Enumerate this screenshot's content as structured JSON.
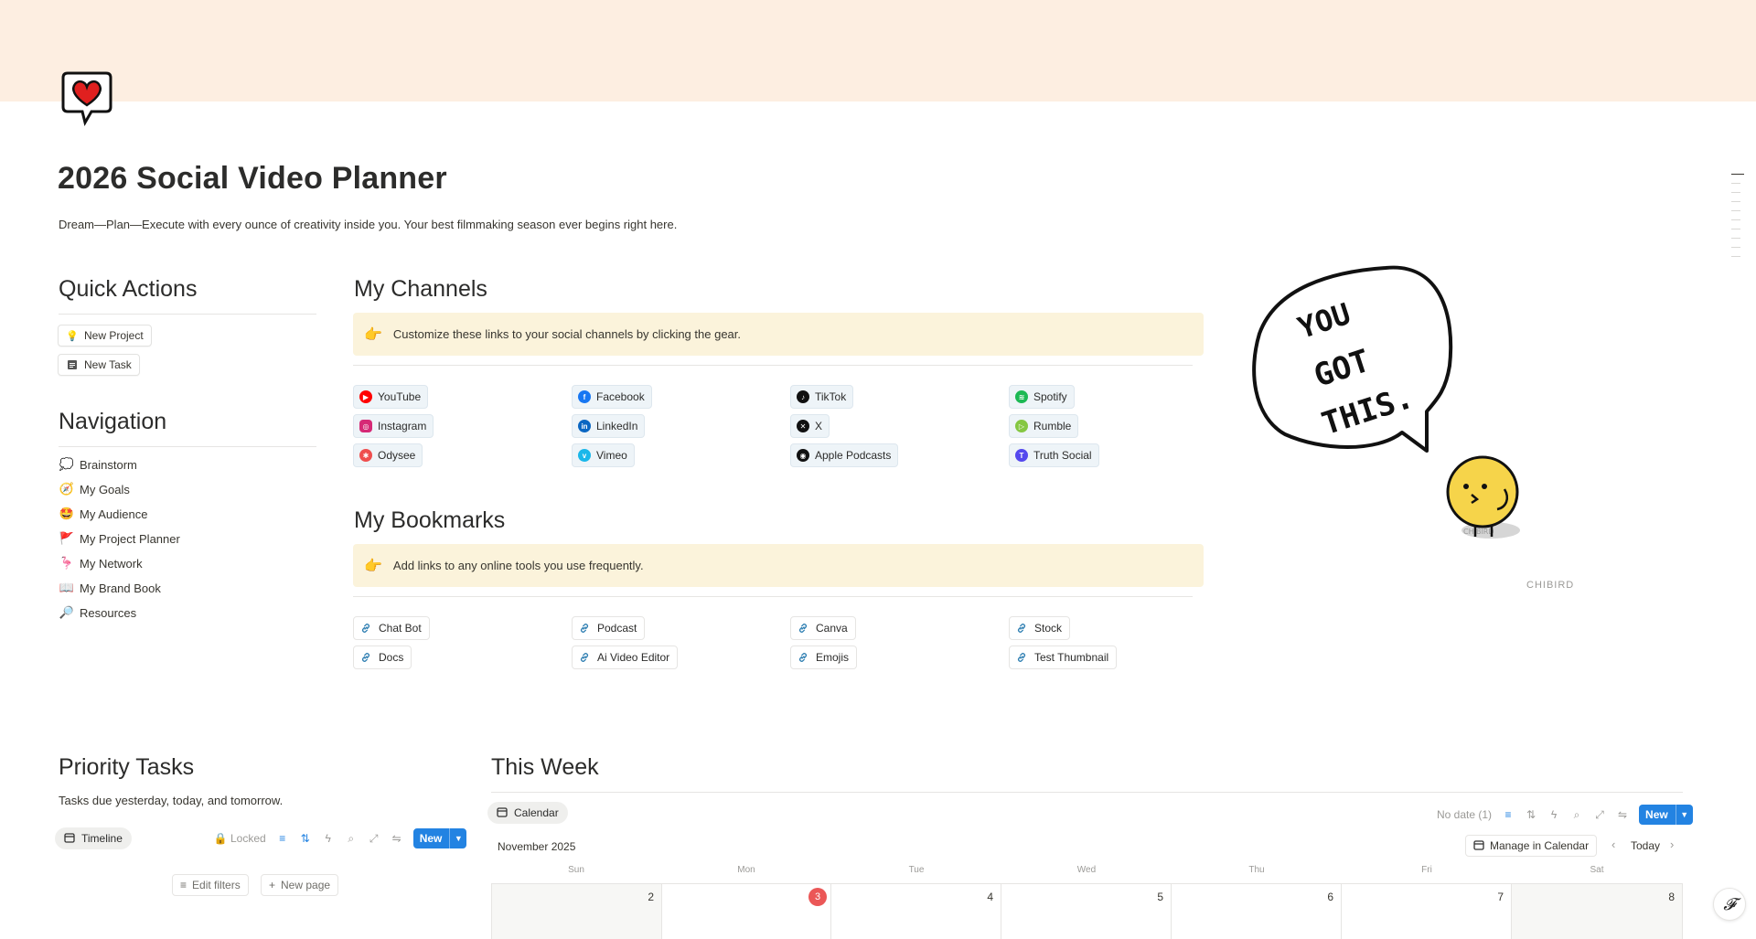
{
  "page": {
    "title": "2026 Social Video Planner",
    "subtitle": "Dream—Plan—Execute with every ounce of creativity inside you. Your best filmmaking season ever begins right here.",
    "icon": "heart-speech-bubble-icon"
  },
  "quick_actions": {
    "heading": "Quick Actions",
    "buttons": [
      {
        "label": "New Project",
        "icon": "lightbulb-icon"
      },
      {
        "label": "New Task",
        "icon": "notepad-icon"
      }
    ]
  },
  "navigation": {
    "heading": "Navigation",
    "items": [
      {
        "label": "Brainstorm",
        "icon": "thought-bubble-icon"
      },
      {
        "label": "My Goals",
        "icon": "compass-icon"
      },
      {
        "label": "My Audience",
        "icon": "star-eyes-face-icon"
      },
      {
        "label": "My Project Planner",
        "icon": "flag-icon"
      },
      {
        "label": "My Network",
        "icon": "flamingo-icon"
      },
      {
        "label": "My Brand Book",
        "icon": "open-book-icon"
      },
      {
        "label": "Resources",
        "icon": "magnifier-icon"
      }
    ]
  },
  "channels": {
    "heading": "My Channels",
    "callout": "Customize these links to your social channels by clicking the gear.",
    "callout_icon": "pointing-hand-icon",
    "items": [
      {
        "label": "YouTube",
        "icon": "youtube-icon",
        "color": "#ff0000"
      },
      {
        "label": "Instagram",
        "icon": "instagram-icon",
        "color": "#d62976"
      },
      {
        "label": "Odysee",
        "icon": "odysee-icon",
        "color": "#ef4e4e"
      },
      {
        "label": "Facebook",
        "icon": "facebook-icon",
        "color": "#1877f2"
      },
      {
        "label": "LinkedIn",
        "icon": "linkedin-icon",
        "color": "#0a66c2"
      },
      {
        "label": "Vimeo",
        "icon": "vimeo-icon",
        "color": "#1ab7ea"
      },
      {
        "label": "TikTok",
        "icon": "tiktok-icon",
        "color": "#111111"
      },
      {
        "label": "X",
        "icon": "x-icon",
        "color": "#111111"
      },
      {
        "label": "Apple Podcasts",
        "icon": "podcast-icon",
        "color": "#111111"
      },
      {
        "label": "Spotify",
        "icon": "spotify-icon",
        "color": "#1db954"
      },
      {
        "label": "Rumble",
        "icon": "rumble-icon",
        "color": "#85c742"
      },
      {
        "label": "Truth Social",
        "icon": "truth-social-icon",
        "color": "#5448ee"
      }
    ]
  },
  "bookmarks": {
    "heading": "My Bookmarks",
    "callout": "Add links to any online tools you use frequently.",
    "callout_icon": "pointing-hand-icon",
    "items": [
      {
        "label": "Chat Bot"
      },
      {
        "label": "Docs"
      },
      {
        "label": "Podcast"
      },
      {
        "label": "Ai Video Editor"
      },
      {
        "label": "Canva"
      },
      {
        "label": "Emojis"
      },
      {
        "label": "Stock"
      },
      {
        "label": "Test Thumbnail"
      }
    ]
  },
  "illustration": {
    "bubble_text": [
      "YOU",
      "GOT",
      "THIS."
    ],
    "brand": "CHIBIRD",
    "chick_label": "CHIBIRD"
  },
  "priority_tasks": {
    "heading": "Priority Tasks",
    "description": "Tasks due yesterday, today, and tomorrow.",
    "view_tab": "Timeline",
    "locked_label": "Locked",
    "new_label": "New",
    "edit_filters": "Edit filters",
    "new_page": "New page"
  },
  "this_week": {
    "heading": "This Week",
    "view_tab": "Calendar",
    "no_date": "No date (1)",
    "new_label": "New",
    "month": "November 2025",
    "manage_label": "Manage in Calendar",
    "today_label": "Today",
    "days": [
      "Sun",
      "Mon",
      "Tue",
      "Wed",
      "Thu",
      "Fri",
      "Sat"
    ],
    "dates": [
      "2",
      "3",
      "4",
      "5",
      "6",
      "7",
      "8"
    ],
    "today_date": "3"
  },
  "colors": {
    "cover": "#fdeee1",
    "callout": "#fbf3db",
    "accent": "#2383e2",
    "today": "#eb5757"
  }
}
